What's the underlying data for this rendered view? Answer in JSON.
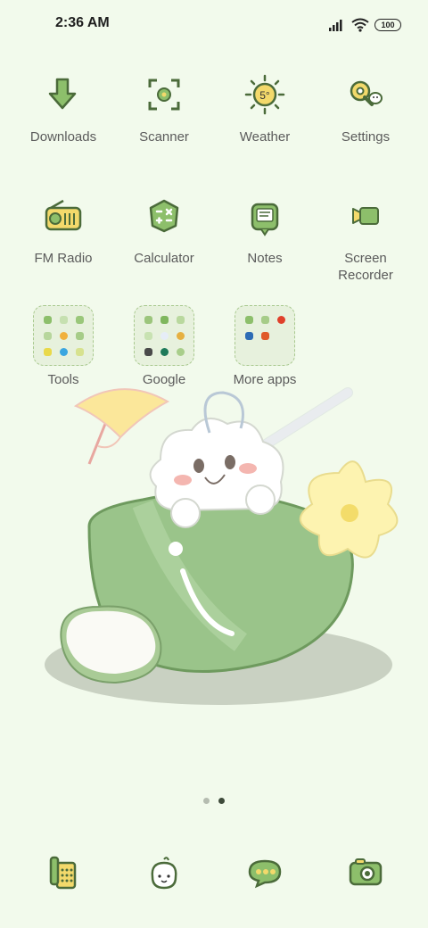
{
  "status": {
    "time": "2:36 AM",
    "battery": "100"
  },
  "apps_row1": [
    {
      "label": "Downloads",
      "icon": "downloads-icon"
    },
    {
      "label": "Scanner",
      "icon": "scanner-icon"
    },
    {
      "label": "Weather",
      "icon": "weather-icon",
      "badge": "5°"
    },
    {
      "label": "Settings",
      "icon": "settings-icon"
    }
  ],
  "apps_row2": [
    {
      "label": "FM Radio",
      "icon": "radio-icon"
    },
    {
      "label": "Calculator",
      "icon": "calculator-icon"
    },
    {
      "label": "Notes",
      "icon": "notes-icon"
    },
    {
      "label": "Screen Recorder",
      "icon": "screen-recorder-icon"
    }
  ],
  "folders": [
    {
      "label": "Tools"
    },
    {
      "label": "Google"
    },
    {
      "label": "More apps"
    }
  ],
  "dock": [
    {
      "icon": "phone-icon"
    },
    {
      "icon": "contacts-icon"
    },
    {
      "icon": "messages-icon"
    },
    {
      "icon": "camera-icon"
    }
  ],
  "pages": {
    "count": 2,
    "active": 2
  },
  "colors": {
    "background": "#f2faec",
    "icon_green": "#8dbf6b",
    "icon_outline": "#4b6b3a",
    "accent_yellow": "#f3d96b"
  }
}
